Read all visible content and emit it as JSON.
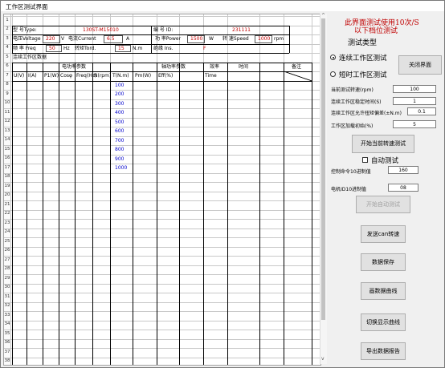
{
  "window": {
    "title": "工作区测试界面"
  },
  "info": {
    "type_label": "型 号Type:",
    "type_value": "130ST-M15010",
    "id_label": "编 号 ID:",
    "id_value": "231111",
    "voltage_label": "电压Voltage",
    "voltage_value": "220",
    "voltage_unit": "V",
    "current_label": "电流Current",
    "current_value": "6.5",
    "current_unit": "A",
    "power_label": "功 率Power",
    "power_value": "1500",
    "power_unit": "W",
    "speed_label": "转 速Speed",
    "speed_value": "1000",
    "speed_unit": "rpm",
    "freq_label": "频 率 Freq",
    "freq_value": "50",
    "freq_unit": "Hz",
    "torque_label": "转矩Tord.",
    "torque_value": "15",
    "torque_unit": "N.m",
    "ins_label": "绝缘 Ins.",
    "ins_value": "F"
  },
  "section_title": "连续工作区数据",
  "table": {
    "group_input": "电功率参数",
    "group_output": "轴功率参数",
    "group_eff": "效率",
    "group_time": "时间",
    "group_note": "备注",
    "columns": [
      "U(V)",
      "I(A)",
      "P1(W)",
      "Cosφ",
      "Freq(Hz)",
      "N(rpm)",
      "T(N.m)",
      "Pm(W)",
      "Eff(%)",
      "Time"
    ],
    "speeds": [
      "100",
      "200",
      "300",
      "400",
      "500",
      "600",
      "700",
      "800",
      "900",
      "1000"
    ]
  },
  "row_numbers": [
    "1",
    "2",
    "3",
    "4",
    "5",
    "6",
    "7",
    "8",
    "9",
    "10",
    "11",
    "12",
    "13",
    "14",
    "15",
    "16",
    "17",
    "18",
    "19",
    "20",
    "21",
    "22",
    "23",
    "24",
    "25",
    "26",
    "27",
    "28",
    "29",
    "30",
    "31",
    "32",
    "33",
    "34",
    "35",
    "36",
    "37",
    "38"
  ],
  "panel": {
    "warning_line1": "此界面测试使用10次/S",
    "warning_line2": "以下档位测试",
    "test_type_label": "测试类型",
    "radio_continuous": "连续工作区测试",
    "radio_short": "短时工作区测试",
    "close_button": "关闭界面",
    "target_speed_label": "当前测试转速(rpm)",
    "target_speed_value": "100",
    "stable_time_label": "连续工作区稳定时间(S)",
    "stable_time_value": "1",
    "torque_dev_label": "连续工作区允许扭矩偏差(±N.m)",
    "torque_dev_value": "0.1",
    "load_init_label": "工作区加载初始(%)",
    "load_init_value": "5",
    "start_speed_button": "开始当前转速测试",
    "auto_test_label": "自动测试",
    "control_cmd_label": "控制命令10进制值",
    "control_cmd_value": "160",
    "motor_id_label": "电机ID10进制值",
    "motor_id_value": "08",
    "start_auto_button": "开始自动测试",
    "send_can_button": "发送can转速",
    "save_button": "数据保存",
    "draw_curve_button": "画数据曲线",
    "toggle_curve_button": "切换显示曲线",
    "export_button": "导出数据报告"
  }
}
